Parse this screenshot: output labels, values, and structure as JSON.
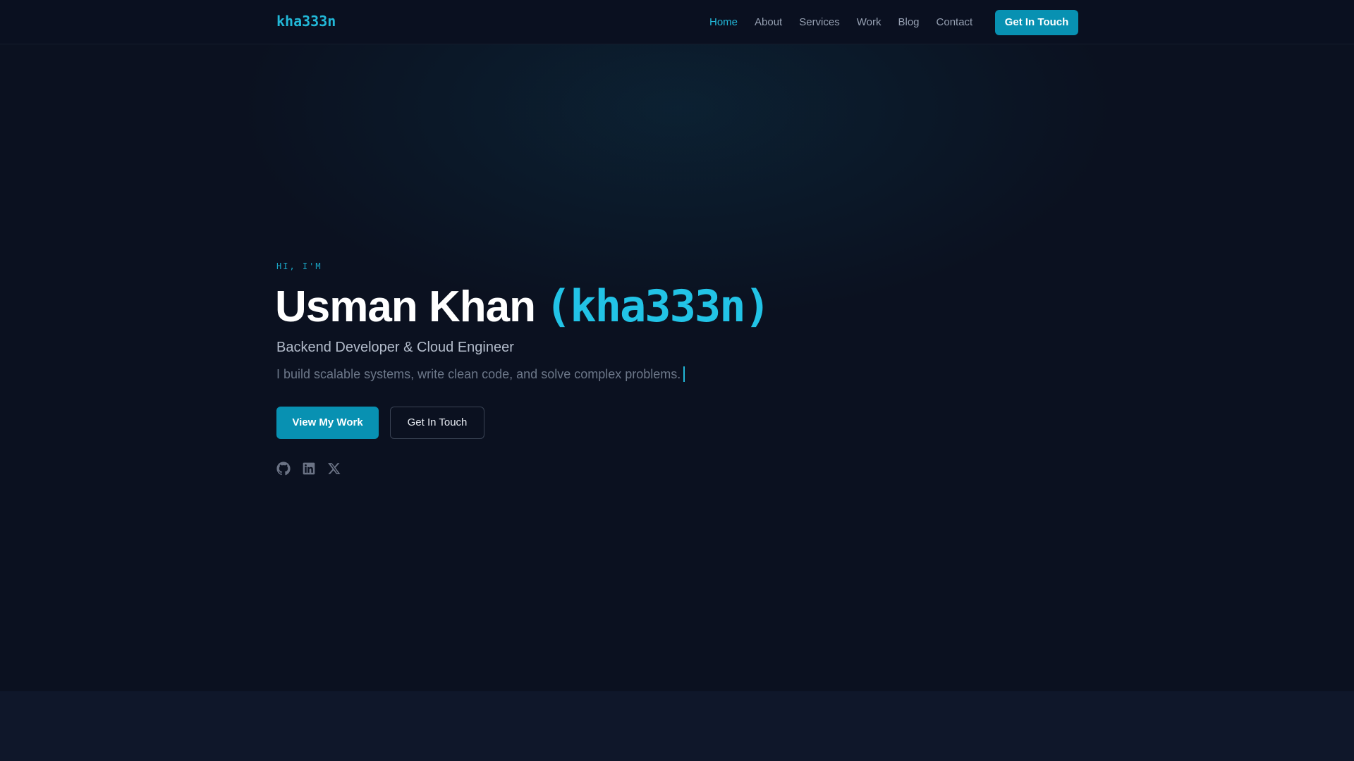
{
  "nav": {
    "brand": "kha333n",
    "links": [
      {
        "label": "Home",
        "active": true
      },
      {
        "label": "About",
        "active": false
      },
      {
        "label": "Services",
        "active": false
      },
      {
        "label": "Work",
        "active": false
      },
      {
        "label": "Blog",
        "active": false
      },
      {
        "label": "Contact",
        "active": false
      }
    ],
    "cta": "Get In Touch"
  },
  "hero": {
    "eyebrow": "HI, I'M",
    "name": "Usman Khan",
    "handle": "(kha333n)",
    "role": "Backend Developer & Cloud Engineer",
    "tagline": "I build scalable systems, write clean code, and solve complex problems.",
    "primary_button": "View My Work",
    "secondary_button": "Get In Touch",
    "socials": [
      {
        "icon": "github-icon"
      },
      {
        "icon": "linkedin-icon"
      },
      {
        "icon": "x-icon"
      }
    ]
  },
  "colors": {
    "accent": "#22b8d8",
    "button": "#0891b2",
    "background": "#0b1120"
  }
}
